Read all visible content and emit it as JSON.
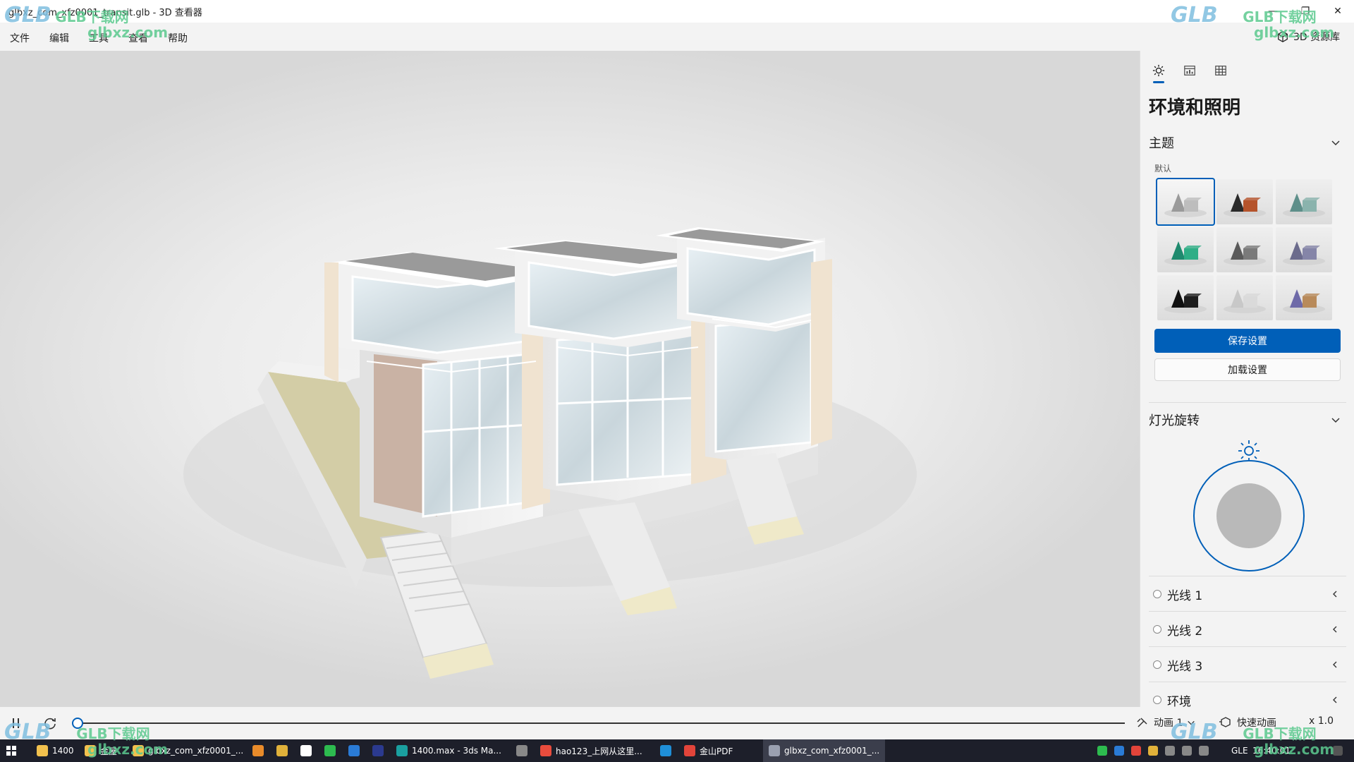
{
  "window": {
    "title": "glbxz_com_xfz0001_transit.glb - 3D 查看器",
    "minimize_glyph": "—",
    "maximize_glyph": "❐",
    "close_glyph": "✕"
  },
  "menu": {
    "file": "文件",
    "edit": "编辑",
    "tools": "工具",
    "view": "查看",
    "help": "帮助",
    "library": "3D 资源库"
  },
  "panel": {
    "tabs": [
      "sun-icon",
      "stats-icon",
      "grid-icon"
    ],
    "title": "环境和照明",
    "theme": {
      "header": "主题",
      "default_label": "默认",
      "selected_index": 0,
      "swatches": [
        {
          "cone": "#9a9a9a",
          "cube": "#bdbdbd"
        },
        {
          "cone": "#2a2a2a",
          "cube": "#b5532b",
          "accent": "#c24a1d"
        },
        {
          "cone": "#5e8f8a",
          "cube": "#8ab3ad"
        },
        {
          "cone": "#1f8a6e",
          "cube": "#2fae86"
        },
        {
          "cone": "#5a5a5a",
          "cube": "#7a7a7a"
        },
        {
          "cone": "#6b6b8c",
          "cube": "#8585a8"
        },
        {
          "cone": "#111111",
          "cube": "#1e1e1e"
        },
        {
          "cone": "#c8c8c8",
          "cube": "#dadada"
        },
        {
          "cone": "#6e6aa8",
          "cube": "#b88a5a"
        }
      ]
    },
    "save_button": "保存设置",
    "load_button": "加载设置",
    "light_rotation": {
      "header": "灯光旋转"
    },
    "lights": [
      {
        "label": "光线 1"
      },
      {
        "label": "光线 2"
      },
      {
        "label": "光线 3"
      },
      {
        "label": "环境"
      }
    ]
  },
  "timeline": {
    "progress": 0,
    "animation_label": "动画 1",
    "quick_animation": "快速动画",
    "speed": "x 1.0"
  },
  "taskbar": {
    "items": [
      {
        "label": "1400",
        "color": "#f2c14e"
      },
      {
        "label": "金屋",
        "color": "#f2c14e"
      },
      {
        "label": "glbxz_com_xfz0001_...",
        "color": "#f2c14e"
      },
      {
        "label": "",
        "color": "#e98b2a"
      },
      {
        "label": "",
        "color": "#e0b13a"
      },
      {
        "label": "",
        "color": "#ffffff"
      },
      {
        "label": "",
        "color": "#2dbb4f"
      },
      {
        "label": "",
        "color": "#2a7bd6"
      },
      {
        "label": "",
        "color": "#2b3a8f"
      },
      {
        "label": "1400.max - 3ds Ma...",
        "color": "#1aa0a0"
      },
      {
        "label": "",
        "color": "#888888"
      },
      {
        "label": "hao123_上网从这里...",
        "color": "#e84c3d"
      },
      {
        "label": "",
        "color": "#1f8fd8"
      },
      {
        "label": "金山PDF",
        "color": "#e2443a"
      },
      {
        "label": "glbxz_com_xfz0001_...",
        "color": "#9aa0b0"
      }
    ],
    "ime": "GLE",
    "time": "16:40:01"
  },
  "watermark": {
    "brand": "GLB",
    "cn": "GLB下载网",
    "domain": "glbxz.com"
  }
}
